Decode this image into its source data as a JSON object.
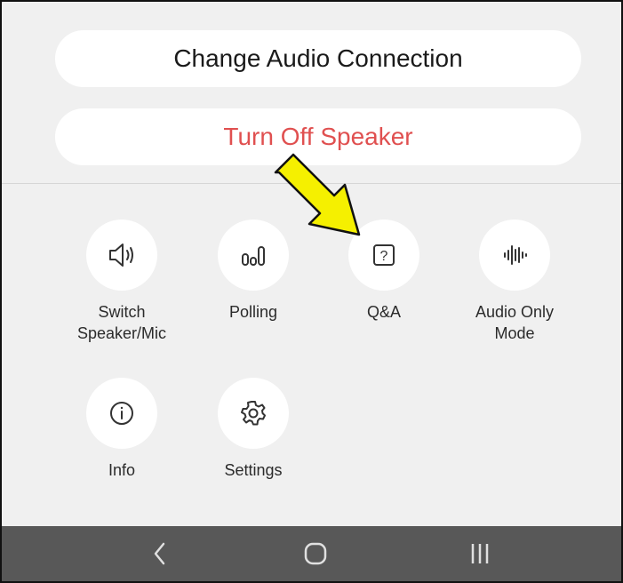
{
  "audio_menu": {
    "change_audio_connection": "Change Audio Connection",
    "turn_off_speaker": "Turn Off Speaker"
  },
  "actions": [
    {
      "label": "Switch\nSpeaker/Mic",
      "icon": "speaker-icon"
    },
    {
      "label": "Polling",
      "icon": "polling-icon"
    },
    {
      "label": "Q&A",
      "icon": "qa-icon"
    },
    {
      "label": "Audio Only\nMode",
      "icon": "audio-wave-icon"
    },
    {
      "label": "Info",
      "icon": "info-icon"
    },
    {
      "label": "Settings",
      "icon": "gear-icon"
    }
  ],
  "nav": {
    "back": "back-icon",
    "home": "home-icon",
    "recents": "recents-icon"
  },
  "colors": {
    "accent_red": "#e05050",
    "highlight_arrow": "#f5f000",
    "navbar": "#585858"
  }
}
